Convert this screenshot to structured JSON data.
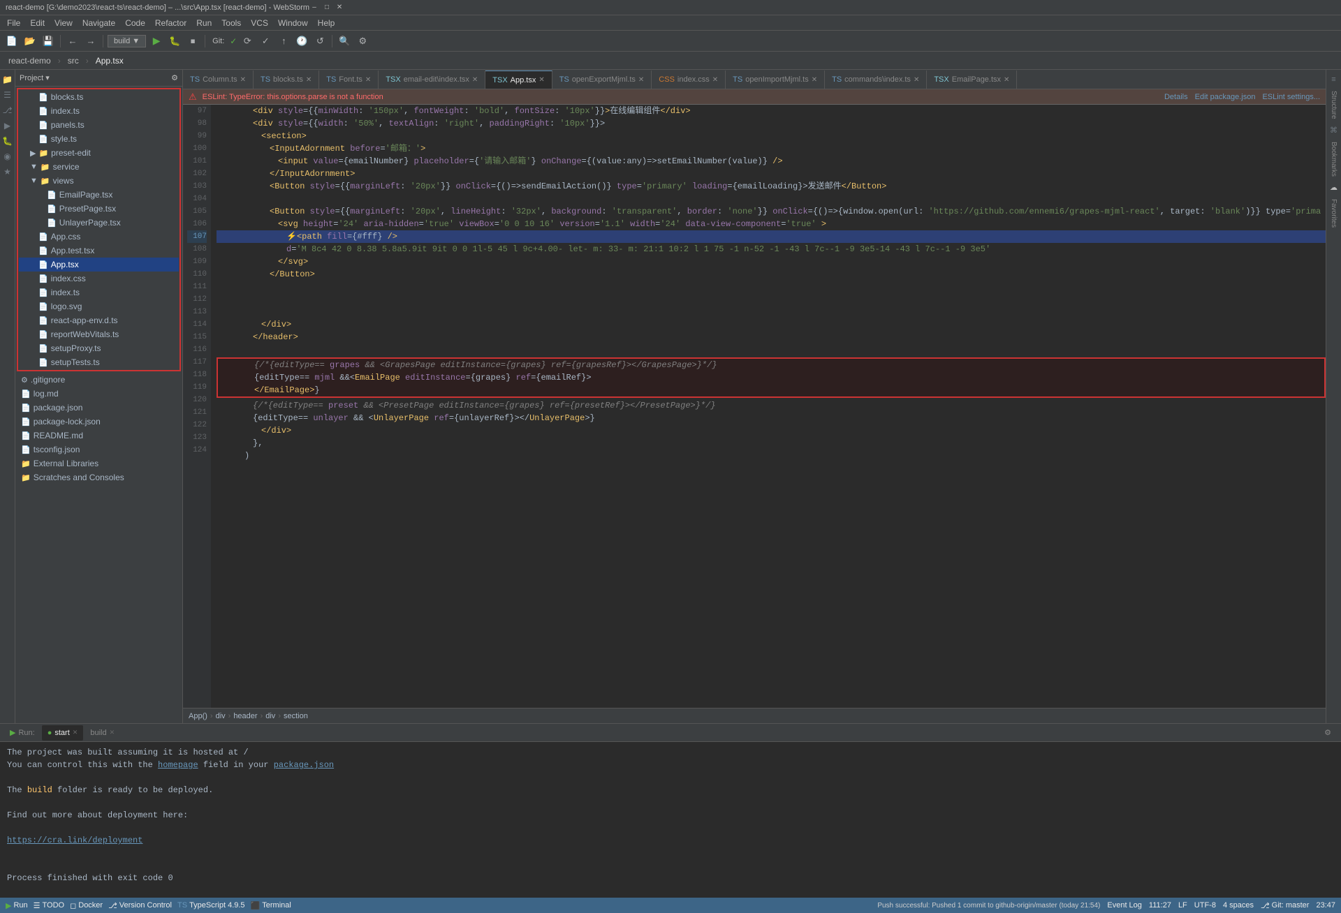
{
  "titleBar": {
    "title": "react-demo [G:\\demo2023\\react-ts\\react-demo] – ...\\src\\App.tsx [react-demo] - WebStorm",
    "minimize": "–",
    "maximize": "□",
    "close": "✕"
  },
  "menuBar": {
    "items": [
      "File",
      "Edit",
      "View",
      "Navigate",
      "Code",
      "Refactor",
      "Run",
      "Tools",
      "VCS",
      "Window",
      "Help"
    ]
  },
  "toolbar": {
    "buildLabel": "build",
    "gitLabel": "Git:"
  },
  "navBar": {
    "projectLabel": "Project",
    "srcLabel": "src",
    "fileLabel": "App.tsx"
  },
  "tabs": [
    {
      "label": "Column.ts",
      "type": "ts",
      "active": false
    },
    {
      "label": "blocks.ts",
      "type": "ts",
      "active": false
    },
    {
      "label": "Font.ts",
      "type": "ts",
      "active": false
    },
    {
      "label": "email-edit\\index.tsx",
      "type": "tsx",
      "active": false
    },
    {
      "label": "App.tsx",
      "type": "tsx",
      "active": true
    },
    {
      "label": "openExportMjml.ts",
      "type": "ts",
      "active": false
    },
    {
      "label": "index.css",
      "type": "css",
      "active": false
    },
    {
      "label": "openImportMjml.ts",
      "type": "ts",
      "active": false
    },
    {
      "label": "commands\\index.ts",
      "type": "ts",
      "active": false
    },
    {
      "label": "EmailPage.tsx",
      "type": "tsx",
      "active": false
    }
  ],
  "errorBar": {
    "icon": "⚠",
    "message": "ESLint: TypeError: this.options.parse is not a function",
    "details": "Details",
    "editPackage": "Edit package.json",
    "eslintSettings": "ESLint settings..."
  },
  "codeLines": [
    {
      "num": 97,
      "indent": 3,
      "content": "<div style={{minWidth: '150px', fontWeight: 'bold', fontSize: '10px'}}>在线编辑组件</div>",
      "type": "normal"
    },
    {
      "num": 98,
      "indent": 3,
      "content": "<div style={{width: '50%', textAlign: 'right', paddingRight: '10px'}}>",
      "type": "normal"
    },
    {
      "num": 99,
      "indent": 4,
      "content": "<section>",
      "type": "normal"
    },
    {
      "num": 100,
      "indent": 5,
      "content": "<InputAdornment before='邮箱：'>",
      "type": "normal"
    },
    {
      "num": 101,
      "indent": 6,
      "content": "<input value={emailNumber} placeholder={'请输入邮箱'} onChange={(value:any)=>setEmailNumber(value)} />",
      "type": "normal"
    },
    {
      "num": 102,
      "indent": 5,
      "content": "</InputAdornment>",
      "type": "normal"
    },
    {
      "num": 103,
      "indent": 5,
      "content": "<Button style={{marginLeft: '20px'}} onClick={()=>sendEmailAction()} type='primary' loading={emailLoading}>发送邮件</Button>",
      "type": "normal"
    },
    {
      "num": 104,
      "indent": 4,
      "content": "",
      "type": "normal"
    },
    {
      "num": 105,
      "indent": 5,
      "content": "<Button style={{marginLeft: '20px', lineHeight: '32px', background: 'transparent', border: 'none'}} onClick={()=>{window.open(url: 'https://github.com/ennemi6/grapes-mjml-react', target: 'blank')}} type='prima",
      "type": "normal"
    },
    {
      "num": 106,
      "indent": 6,
      "content": "<svg height='24' aria-hidden='true' viewBox='0 0 10 16' version='1.1' width='24' data-view-component='true' >",
      "type": "normal"
    },
    {
      "num": 107,
      "indent": 7,
      "content": "<path fill={#fff} />",
      "type": "highlighted"
    },
    {
      "num": 108,
      "indent": 7,
      "content": "d='M 8c4 42 0 8.38 5.8a5.9it 9it 0 0 1l-5 45 l 9c+4.00- let- m: 33- m: 21:1 10:2 l 1 75 -1 n-52 -1 -43 l 7c--1 -9 3e5-14 -43 l 7c--1 -9 3e5",
      "type": "normal"
    },
    {
      "num": 109,
      "indent": 6,
      "content": "</svg>",
      "type": "normal"
    },
    {
      "num": 110,
      "indent": 5,
      "content": "</Button>",
      "type": "normal"
    },
    {
      "num": 111,
      "indent": 4,
      "content": "",
      "type": "normal"
    },
    {
      "num": 112,
      "indent": 3,
      "content": "",
      "type": "normal"
    },
    {
      "num": 113,
      "indent": 3,
      "content": "",
      "type": "normal"
    },
    {
      "num": 114,
      "indent": 4,
      "content": "</div>",
      "type": "normal"
    },
    {
      "num": 115,
      "indent": 3,
      "content": "</header>",
      "type": "normal"
    },
    {
      "num": 116,
      "indent": 2,
      "content": "",
      "type": "normal"
    },
    {
      "num": 117,
      "indent": 3,
      "content": "{/*{editType== grapes && <GrapesPage editInstance={grapes} ref={grapesRef}></GrapesPage>}*/}",
      "type": "red-highlighted"
    },
    {
      "num": 118,
      "indent": 3,
      "content": "{editType== mjml &&<EmailPage editInstance={grapes} ref={emailRef}>",
      "type": "red-highlighted"
    },
    {
      "num": 119,
      "indent": 3,
      "content": "</EmailPage>}",
      "type": "red-highlighted"
    },
    {
      "num": 120,
      "indent": 3,
      "content": "{/*{editType== preset && <PresetPage editInstance={grapes} ref={presetRef}></PresetPage>}*/}",
      "type": "normal"
    },
    {
      "num": 121,
      "indent": 3,
      "content": "{editType== unlayer && <UnlayerPage ref={unlayerRef}></UnlayerPage>}",
      "type": "normal"
    },
    {
      "num": 122,
      "indent": 4,
      "content": "</div>",
      "type": "normal"
    },
    {
      "num": 123,
      "indent": 3,
      "content": "},",
      "type": "normal"
    },
    {
      "num": 124,
      "indent": 2,
      "content": ")",
      "type": "normal"
    }
  ],
  "editorBreadcrumb": {
    "items": [
      "App()",
      "div",
      "header",
      "div",
      "section"
    ]
  },
  "bottomTabs": [
    {
      "label": "Run:",
      "active": true
    },
    {
      "label": "start",
      "active": true,
      "hasX": true
    },
    {
      "label": "build",
      "active": false,
      "hasX": true
    }
  ],
  "consoleOutput": [
    {
      "text": "The project was built assuming it is hosted at  /",
      "type": "normal"
    },
    {
      "text": "You can control this with the ",
      "type": "normal",
      "link": "homepage",
      "linkText": "homepage",
      "after": " field in your ",
      "link2": "package.json",
      "linkText2": "package.json"
    },
    {
      "text": "",
      "type": "blank"
    },
    {
      "text": "The build folder is ready to be deployed.",
      "type": "normal"
    },
    {
      "text": "",
      "type": "blank"
    },
    {
      "text": "Find out more about deployment here:",
      "type": "normal"
    },
    {
      "text": "",
      "type": "blank"
    },
    {
      "text": "https://cra.link/deployment",
      "type": "link"
    },
    {
      "text": "",
      "type": "blank"
    },
    {
      "text": "",
      "type": "blank"
    },
    {
      "text": "Process finished with exit code 0",
      "type": "normal"
    }
  ],
  "statusBar": {
    "runIcon": "▶",
    "runLabel": "Run",
    "todoIcon": "☰",
    "todoLabel": "TODO",
    "dockerIcon": "◻",
    "dockerLabel": "Docker",
    "vcIcon": "⎇",
    "vcLabel": "Version Control",
    "tsIcon": "TS",
    "tsLabel": "TypeScript 4.9.5",
    "terminalIcon": "⬛",
    "terminalLabel": "Terminal",
    "position": "111:27",
    "lf": "LF",
    "encoding": "UTF-8",
    "spaces": "4 spaces",
    "git": "Git: master",
    "time": "23:47",
    "pushMessage": "Push successful: Pushed 1 commit to github-origin/master (today 21:54)",
    "eventLog": "Event Log"
  },
  "fileTree": {
    "projectLabel": "Project",
    "items": [
      {
        "name": "blocks.ts",
        "type": "ts",
        "indent": 2
      },
      {
        "name": "index.ts",
        "type": "ts",
        "indent": 2
      },
      {
        "name": "panels.ts",
        "type": "ts",
        "indent": 2
      },
      {
        "name": "style.ts",
        "type": "ts",
        "indent": 2
      },
      {
        "name": "preset-edit",
        "type": "folder",
        "indent": 1
      },
      {
        "name": "service",
        "type": "folder",
        "indent": 1,
        "open": true
      },
      {
        "name": "views",
        "type": "folder",
        "indent": 1,
        "open": true,
        "highlighted": true
      },
      {
        "name": "EmailPage.tsx",
        "type": "tsx",
        "indent": 3
      },
      {
        "name": "PresetPage.tsx",
        "type": "tsx",
        "indent": 3
      },
      {
        "name": "UnlayerPage.tsx",
        "type": "tsx",
        "indent": 3
      },
      {
        "name": "App.css",
        "type": "css",
        "indent": 2
      },
      {
        "name": "App.test.tsx",
        "type": "tsx",
        "indent": 2
      },
      {
        "name": "App.tsx",
        "type": "tsx",
        "indent": 2,
        "selected": true
      },
      {
        "name": "index.css",
        "type": "css",
        "indent": 2
      },
      {
        "name": "index.ts",
        "type": "ts",
        "indent": 2
      },
      {
        "name": "logo.svg",
        "type": "svg",
        "indent": 2
      },
      {
        "name": "react-app-env.d.ts",
        "type": "ts",
        "indent": 2
      },
      {
        "name": "reportWebVitals.ts",
        "type": "ts",
        "indent": 2
      },
      {
        "name": "setupProxy.ts",
        "type": "ts",
        "indent": 2
      },
      {
        "name": "setupTests.ts",
        "type": "ts",
        "indent": 2
      },
      {
        "name": ".gitignore",
        "type": "other",
        "indent": 0
      },
      {
        "name": "log.md",
        "type": "md",
        "indent": 0
      },
      {
        "name": "package.json",
        "type": "json",
        "indent": 0
      },
      {
        "name": "package-lock.json",
        "type": "json",
        "indent": 0
      },
      {
        "name": "README.md",
        "type": "md",
        "indent": 0
      },
      {
        "name": "tsconfig.json",
        "type": "json",
        "indent": 0
      },
      {
        "name": "External Libraries",
        "type": "folder",
        "indent": 0
      },
      {
        "name": "Scratches and Consoles",
        "type": "folder",
        "indent": 0
      }
    ]
  }
}
